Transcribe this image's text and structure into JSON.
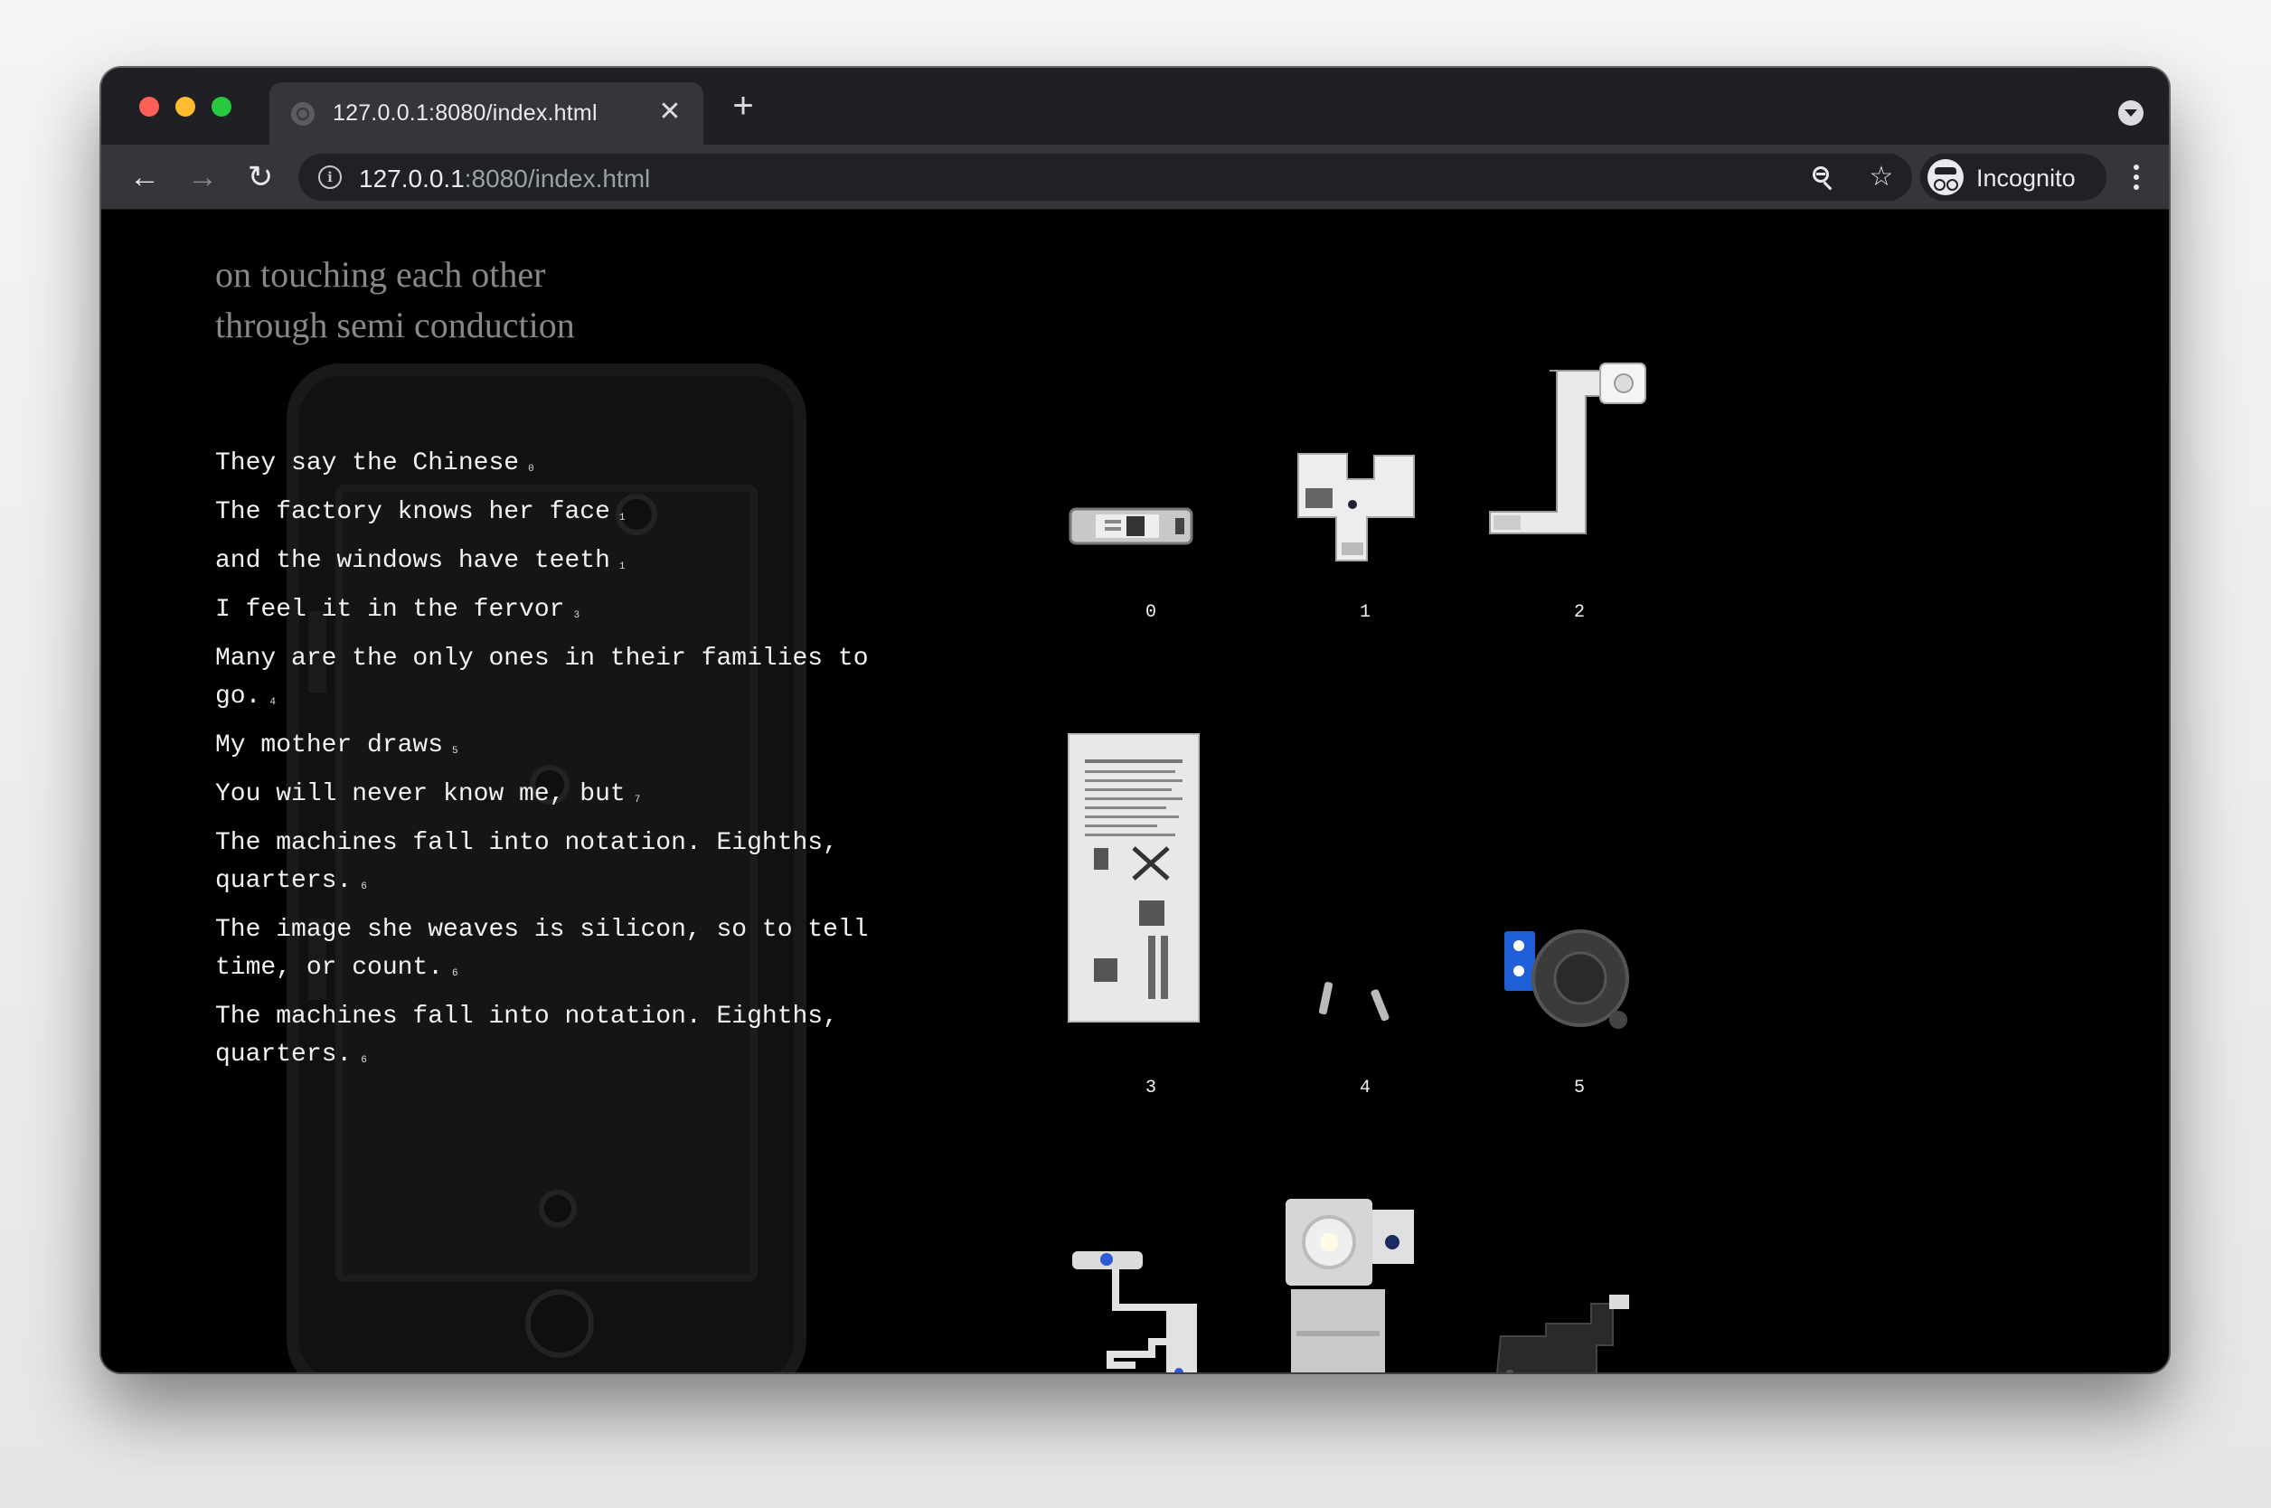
{
  "browser": {
    "tab_title": "127.0.0.1:8080/index.html",
    "tab_close": "✕",
    "new_tab": "+",
    "url_host": "127.0.0.1",
    "url_path": ":8080/index.html",
    "profile_label": "Incognito"
  },
  "page": {
    "title_lines": [
      "on touching each other",
      "through semi conduction"
    ],
    "poem": [
      {
        "text": "They say the Chinese",
        "note": "0"
      },
      {
        "text": "The factory knows her face",
        "note": "1"
      },
      {
        "text": "and the windows have teeth",
        "note": "1"
      },
      {
        "text": "I feel it in the fervor",
        "note": "3"
      },
      {
        "text": "Many are the only ones in their families to go.",
        "note": "4"
      },
      {
        "text": "My mother draws",
        "note": "5"
      },
      {
        "text": "You will never know me, but",
        "note": "7"
      },
      {
        "text": "The machines fall into notation. Eighths, quarters.",
        "note": "6"
      },
      {
        "text": "The image she weaves is silicon, so to tell time, or count.",
        "note": "6"
      },
      {
        "text": "The machines fall into notation. Eighths, quarters.",
        "note": "6"
      }
    ],
    "grid_labels": [
      "0",
      "1",
      "2",
      "3",
      "4",
      "5"
    ]
  },
  "colors": {
    "window_bg": "#000000",
    "chrome_dark": "#1f2023",
    "chrome_mid": "#35363a",
    "title_gray": "#888888",
    "poem_text": "#f2f2f2"
  },
  "icons": [
    "back-arrow-icon",
    "forward-arrow-icon",
    "reload-icon",
    "info-icon",
    "zoom-out-icon",
    "star-icon",
    "incognito-icon",
    "more-vert-icon",
    "tab-search-icon"
  ]
}
